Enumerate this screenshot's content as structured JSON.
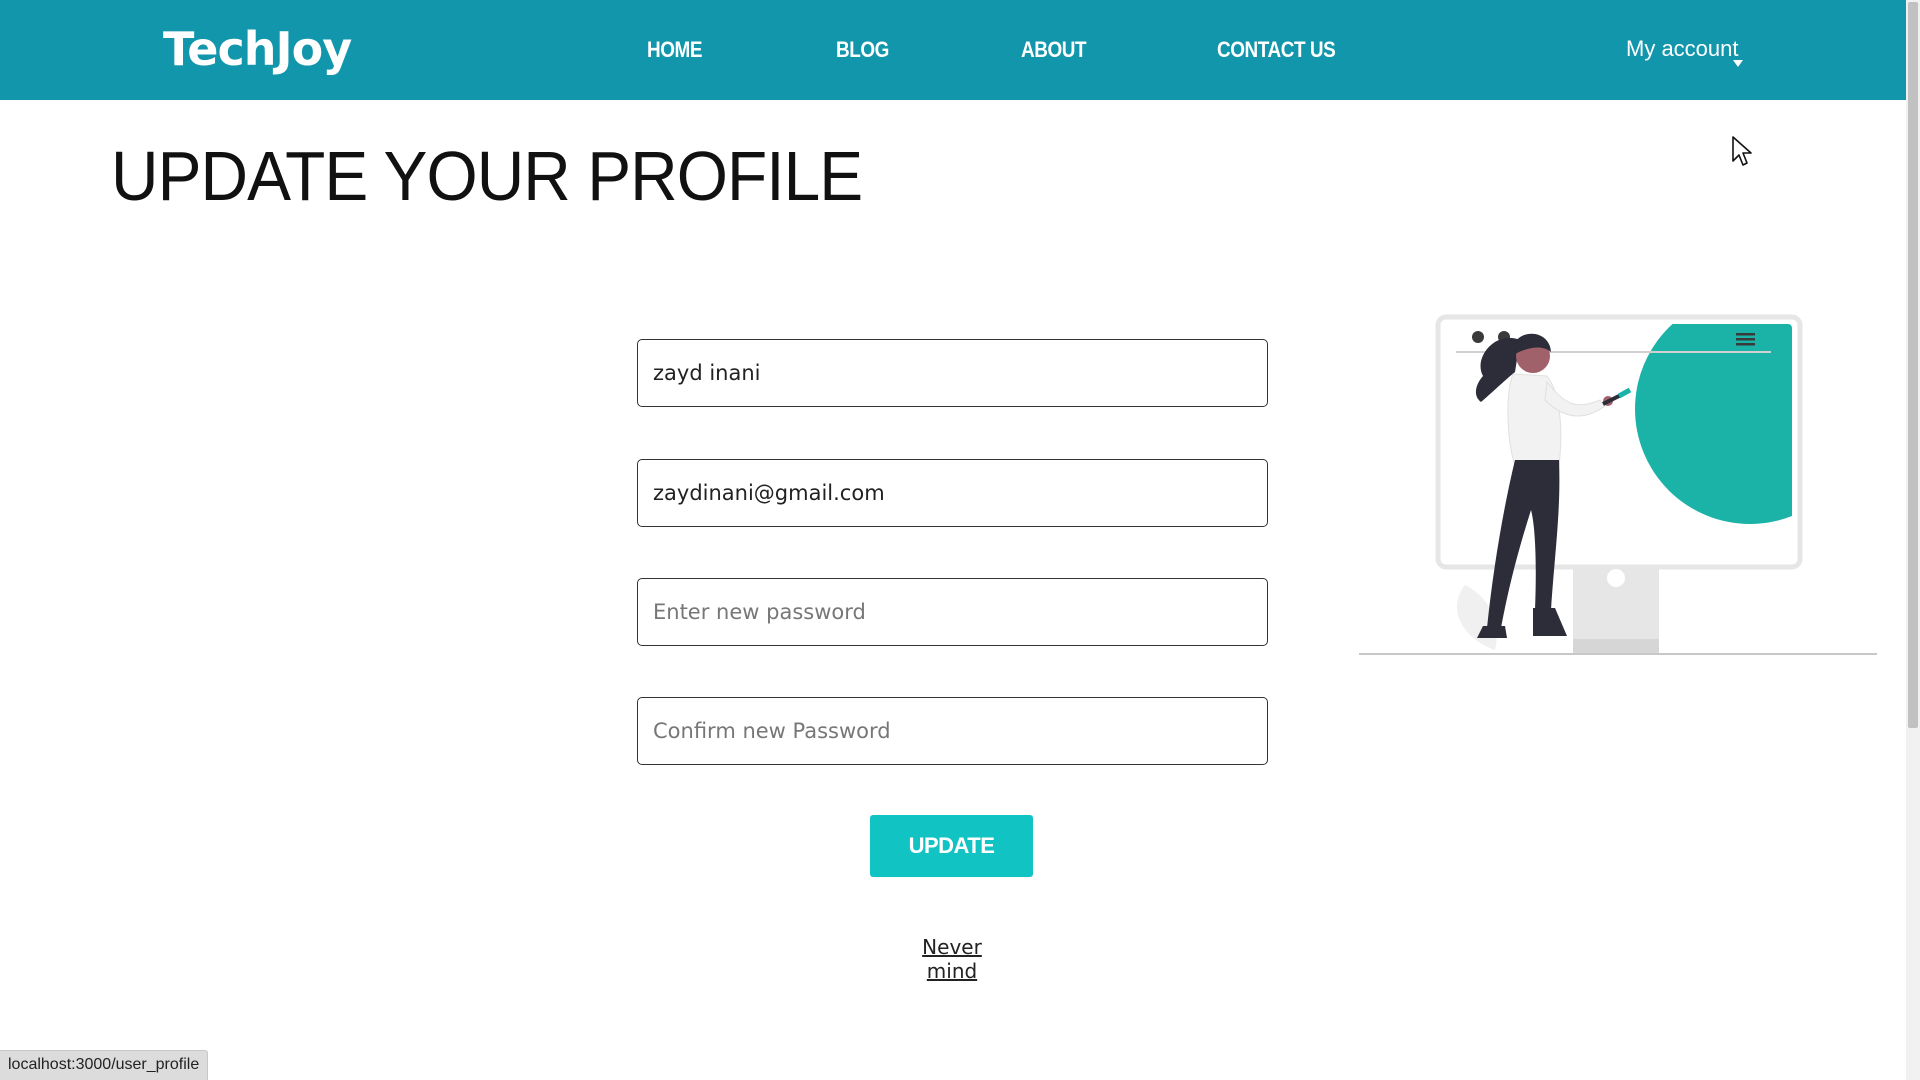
{
  "navbar": {
    "logo": "TechJoy",
    "links": [
      "HOME",
      "BLOG",
      "ABOUT",
      "CONTACT US"
    ],
    "account_label": "My account"
  },
  "page": {
    "title": "UPDATE YOUR PROFILE"
  },
  "form": {
    "name_value": "zayd inani",
    "email_value": "zaydinani@gmail.com",
    "password_placeholder": "Enter new password",
    "confirm_placeholder": "Confirm new Password",
    "update_label": "UPDATE",
    "nevermind_label": "Never mind"
  },
  "status_bar": {
    "url": "localhost:3000/user_profile"
  },
  "colors": {
    "navbar": "#1296ac",
    "accent": "#12c3c3",
    "illustration_teal": "#1bb3a7"
  },
  "icons": {
    "account_caret": "caret-down-icon",
    "cursor": "mouse-pointer-icon",
    "illustration_menu": "hamburger-menu-icon"
  }
}
